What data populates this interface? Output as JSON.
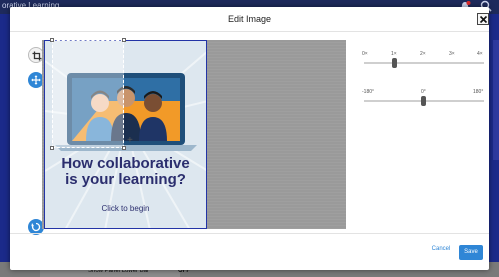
{
  "background_app": {
    "title_fragment": "orative Learning",
    "panel_label": "Show Panel Lower Bar",
    "panel_value": "OFF",
    "icons": [
      "bell-icon",
      "search-icon"
    ]
  },
  "modal": {
    "title": "Edit Image",
    "close_icon": "close-icon",
    "tools": [
      "crop-icon",
      "move-icon",
      "reset-icon"
    ]
  },
  "image": {
    "headline_line1": "How collaborative",
    "headline_line2": "is your learning?",
    "cta": "Click to begin",
    "colors": {
      "frame_border": "#2334a6",
      "background": "#dde7ef",
      "headline": "#2b2e6e",
      "laptop_screen": "#1f4f7a",
      "accent_orange": "#f29a28"
    }
  },
  "zoom_slider": {
    "tick_labels": [
      "0×",
      "1×",
      "2×",
      "3×",
      "4×"
    ],
    "value": 1
  },
  "rotation_slider": {
    "tick_labels": [
      "-180°",
      "0°",
      "180°"
    ],
    "value": 0
  },
  "footer": {
    "cancel_label": "Cancel",
    "save_label": "Save"
  },
  "accent_color": "#2f86d6"
}
